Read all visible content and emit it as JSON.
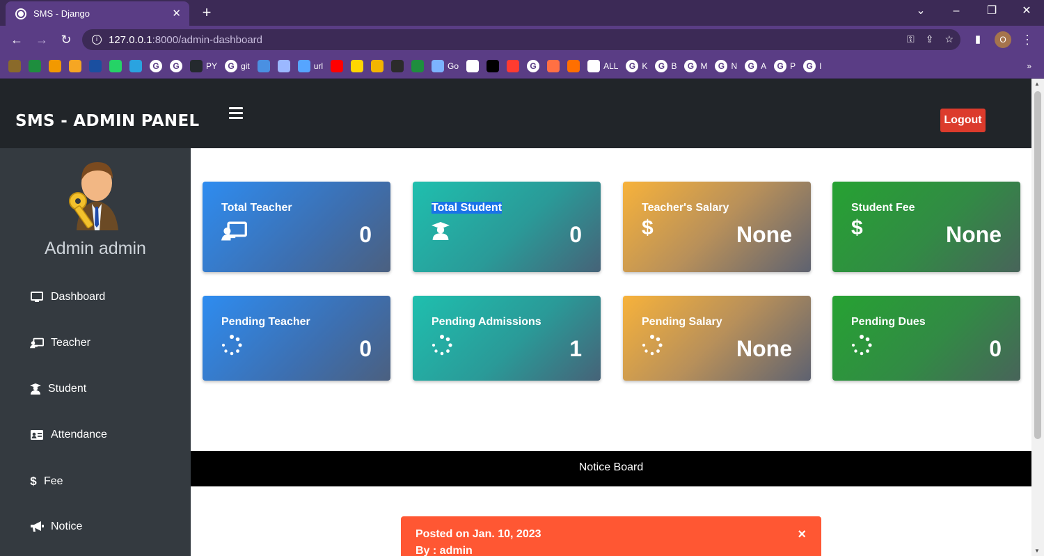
{
  "browser": {
    "tab_title": "SMS - Django",
    "url_host": "127.0.0.1",
    "url_path": ":8000/admin-dashboard",
    "profile_initial": "O",
    "bookmarks": [
      {
        "label": "",
        "color": "#8a6a2a"
      },
      {
        "label": "",
        "color": "#1e8e3e"
      },
      {
        "label": "",
        "color": "#f29900"
      },
      {
        "label": "",
        "color": "#f6a623"
      },
      {
        "label": "",
        "color": "#1a4fa0"
      },
      {
        "label": "",
        "color": "#25d366"
      },
      {
        "label": "",
        "color": "#2aa3e0"
      },
      {
        "label": "",
        "g": "G"
      },
      {
        "label": "",
        "g": "G"
      },
      {
        "label": "PY",
        "color": "#24292e"
      },
      {
        "label": "git",
        "g": "G"
      },
      {
        "label": "",
        "color": "#4a90e2"
      },
      {
        "label": "",
        "color": "#9bb8ff"
      },
      {
        "label": "url",
        "color": "#56a5ff"
      },
      {
        "label": "",
        "color": "#ff0000"
      },
      {
        "label": "",
        "color": "#ffd600"
      },
      {
        "label": "",
        "color": "#f2b500"
      },
      {
        "label": "",
        "color": "#2b2b2b"
      },
      {
        "label": "",
        "color": "#1e8e3e"
      },
      {
        "label": "Go",
        "color": "#7cb3ff"
      },
      {
        "label": "",
        "color": "#ffffff"
      },
      {
        "label": "",
        "color": "#000000"
      },
      {
        "label": "",
        "color": "#ff3b30"
      },
      {
        "label": "",
        "g": "G"
      },
      {
        "label": "",
        "color": "#ff7043"
      },
      {
        "label": "",
        "color": "#ff6f00"
      },
      {
        "label": "ALL",
        "color": "#ffffff"
      },
      {
        "label": "K",
        "g": "G"
      },
      {
        "label": "B",
        "g": "G"
      },
      {
        "label": "M",
        "g": "G"
      },
      {
        "label": "N",
        "g": "G"
      },
      {
        "label": "A",
        "g": "G"
      },
      {
        "label": "P",
        "g": "G"
      },
      {
        "label": "I",
        "g": "G"
      }
    ]
  },
  "header": {
    "brand": "SMS - ADMIN PANEL",
    "logout_label": "Logout"
  },
  "sidebar": {
    "admin_name": "Admin admin",
    "items": [
      {
        "label": "Dashboard",
        "icon": "monitor-icon"
      },
      {
        "label": "Teacher",
        "icon": "chalkboard-teacher-icon"
      },
      {
        "label": "Student",
        "icon": "graduate-icon"
      },
      {
        "label": "Attendance",
        "icon": "id-card-icon"
      },
      {
        "label": "Fee",
        "icon": "dollar-icon"
      },
      {
        "label": "Notice",
        "icon": "megaphone-icon"
      }
    ]
  },
  "cards": [
    {
      "title": "Total Teacher",
      "value": "0",
      "icon": "chalkboard-teacher-icon",
      "color": "#2e8cf0"
    },
    {
      "title": "Total Student",
      "value": "0",
      "icon": "graduate-icon",
      "color": "#1fbfae"
    },
    {
      "title": "Teacher's Salary",
      "value": "None",
      "icon": "dollar-icon",
      "color": "#f7b23b"
    },
    {
      "title": "Student Fee",
      "value": "None",
      "icon": "dollar-icon",
      "color": "#26a232"
    },
    {
      "title": "Pending Teacher",
      "value": "0",
      "icon": "spinner-icon",
      "color": "#2e8cf0"
    },
    {
      "title": "Pending Admissions",
      "value": "1",
      "icon": "spinner-icon",
      "color": "#1fbfae"
    },
    {
      "title": "Pending Salary",
      "value": "None",
      "icon": "spinner-icon",
      "color": "#f7b23b"
    },
    {
      "title": "Pending Dues",
      "value": "0",
      "icon": "spinner-icon",
      "color": "#26a232"
    }
  ],
  "notice_board": {
    "heading": "Notice Board",
    "posted": "Posted on Jan. 10, 2023",
    "by": "By : admin",
    "close_glyph": "×"
  }
}
